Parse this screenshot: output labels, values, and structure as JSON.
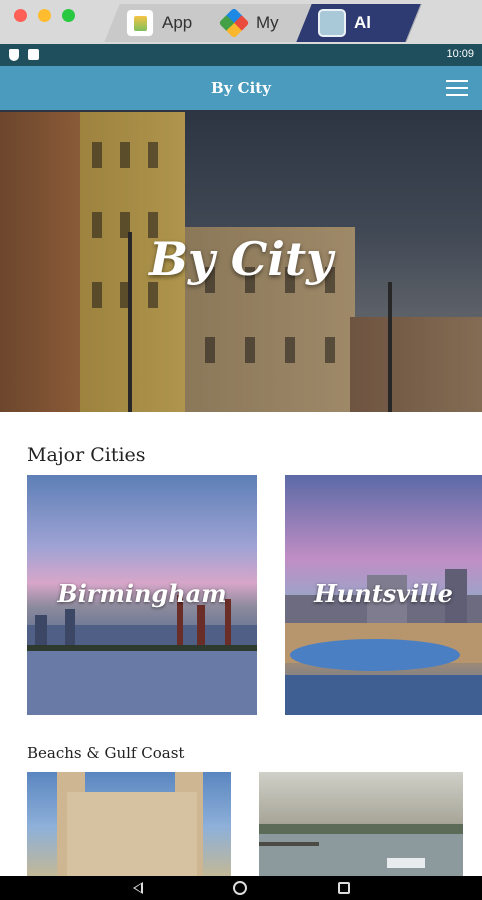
{
  "window": {
    "tabs": [
      {
        "label": "App",
        "icon": "app-center-icon"
      },
      {
        "label": "My",
        "icon": "my-apps-icon"
      },
      {
        "label": "Al",
        "icon": "alabama-app-icon",
        "active": true
      }
    ]
  },
  "status_bar": {
    "time": "10:09"
  },
  "app_bar": {
    "title": "By City",
    "menu_icon": "hamburger-menu-icon"
  },
  "hero": {
    "title": "By City"
  },
  "sections": {
    "major": {
      "title": "Major Cities",
      "cards": [
        {
          "label": "Birmingham"
        },
        {
          "label": "Huntsville"
        }
      ]
    },
    "beach": {
      "title": "Beachs & Gulf Coast"
    }
  },
  "nav": {
    "back": "back-icon",
    "home": "home-icon",
    "recents": "recents-icon"
  },
  "colors": {
    "app_bar": "#4a9bbd",
    "status_bar": "#1f4e5d",
    "active_tab": "#2e3b73"
  }
}
